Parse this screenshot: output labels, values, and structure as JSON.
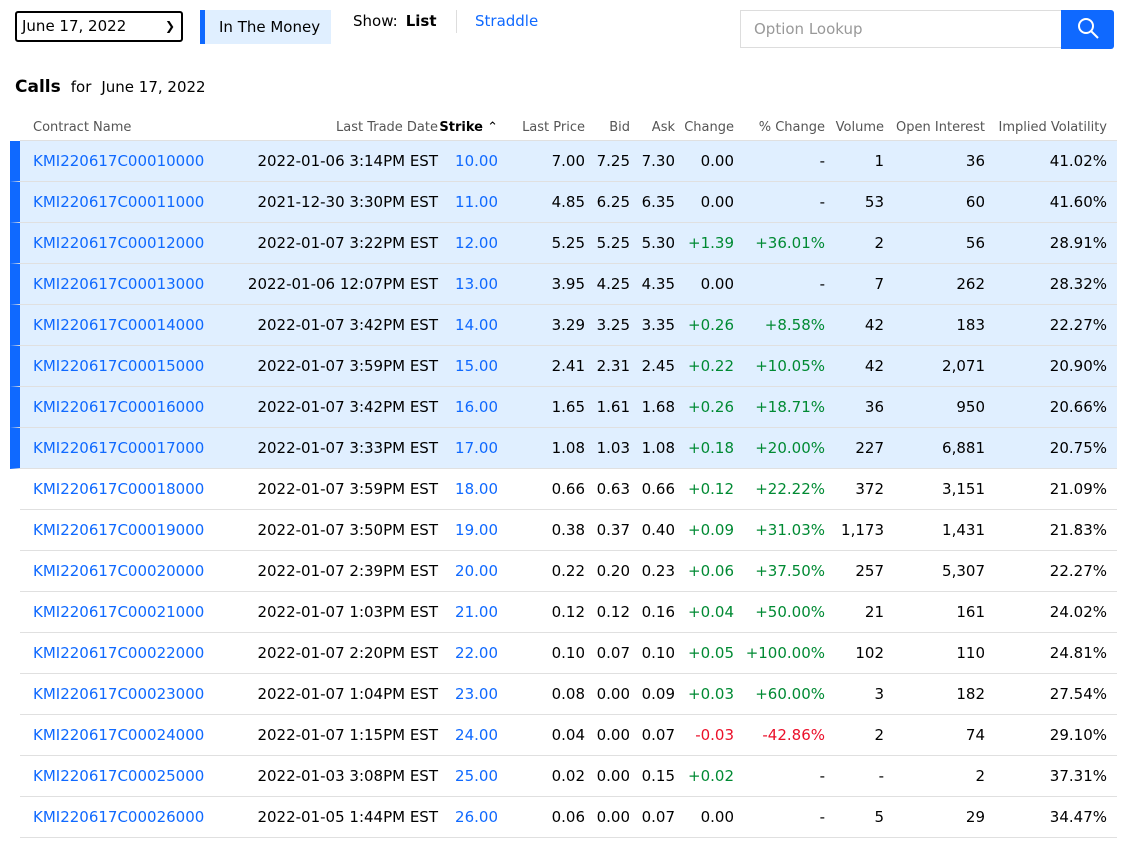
{
  "controls": {
    "date_select": "June 17, 2022",
    "in_the_money": "In The Money",
    "show_label": "Show:",
    "list": "List",
    "straddle": "Straddle",
    "lookup_placeholder": "Option Lookup"
  },
  "section": {
    "title": "Calls",
    "for": "for",
    "date": "June 17, 2022"
  },
  "colors": {
    "accent": "#0f69ff",
    "itm_bg": "#e0efff",
    "positive": "#008a33",
    "negative": "#eb0f29"
  },
  "columns": [
    "Contract Name",
    "Last Trade Date",
    "Strike",
    "Last Price",
    "Bid",
    "Ask",
    "Change",
    "% Change",
    "Volume",
    "Open Interest",
    "Implied Volatility"
  ],
  "sort": {
    "column": "Strike",
    "direction": "ascending"
  },
  "rows": [
    {
      "itm": true,
      "c": [
        "KMI220617C00010000",
        "2022-01-06 3:14PM EST",
        "10.00",
        "7.00",
        "7.25",
        "7.30",
        "0.00",
        "-",
        "1",
        "36",
        "41.02%"
      ]
    },
    {
      "itm": true,
      "c": [
        "KMI220617C00011000",
        "2021-12-30 3:30PM EST",
        "11.00",
        "4.85",
        "6.25",
        "6.35",
        "0.00",
        "-",
        "53",
        "60",
        "41.60%"
      ]
    },
    {
      "itm": true,
      "c": [
        "KMI220617C00012000",
        "2022-01-07 3:22PM EST",
        "12.00",
        "5.25",
        "5.25",
        "5.30",
        "+1.39",
        "+36.01%",
        "2",
        "56",
        "28.91%"
      ]
    },
    {
      "itm": true,
      "c": [
        "KMI220617C00013000",
        "2022-01-06 12:07PM EST",
        "13.00",
        "3.95",
        "4.25",
        "4.35",
        "0.00",
        "-",
        "7",
        "262",
        "28.32%"
      ]
    },
    {
      "itm": true,
      "c": [
        "KMI220617C00014000",
        "2022-01-07 3:42PM EST",
        "14.00",
        "3.29",
        "3.25",
        "3.35",
        "+0.26",
        "+8.58%",
        "42",
        "183",
        "22.27%"
      ]
    },
    {
      "itm": true,
      "c": [
        "KMI220617C00015000",
        "2022-01-07 3:59PM EST",
        "15.00",
        "2.41",
        "2.31",
        "2.45",
        "+0.22",
        "+10.05%",
        "42",
        "2,071",
        "20.90%"
      ]
    },
    {
      "itm": true,
      "c": [
        "KMI220617C00016000",
        "2022-01-07 3:42PM EST",
        "16.00",
        "1.65",
        "1.61",
        "1.68",
        "+0.26",
        "+18.71%",
        "36",
        "950",
        "20.66%"
      ]
    },
    {
      "itm": true,
      "c": [
        "KMI220617C00017000",
        "2022-01-07 3:33PM EST",
        "17.00",
        "1.08",
        "1.03",
        "1.08",
        "+0.18",
        "+20.00%",
        "227",
        "6,881",
        "20.75%"
      ]
    },
    {
      "itm": false,
      "c": [
        "KMI220617C00018000",
        "2022-01-07 3:59PM EST",
        "18.00",
        "0.66",
        "0.63",
        "0.66",
        "+0.12",
        "+22.22%",
        "372",
        "3,151",
        "21.09%"
      ]
    },
    {
      "itm": false,
      "c": [
        "KMI220617C00019000",
        "2022-01-07 3:50PM EST",
        "19.00",
        "0.38",
        "0.37",
        "0.40",
        "+0.09",
        "+31.03%",
        "1,173",
        "1,431",
        "21.83%"
      ]
    },
    {
      "itm": false,
      "c": [
        "KMI220617C00020000",
        "2022-01-07 2:39PM EST",
        "20.00",
        "0.22",
        "0.20",
        "0.23",
        "+0.06",
        "+37.50%",
        "257",
        "5,307",
        "22.27%"
      ]
    },
    {
      "itm": false,
      "c": [
        "KMI220617C00021000",
        "2022-01-07 1:03PM EST",
        "21.00",
        "0.12",
        "0.12",
        "0.16",
        "+0.04",
        "+50.00%",
        "21",
        "161",
        "24.02%"
      ]
    },
    {
      "itm": false,
      "c": [
        "KMI220617C00022000",
        "2022-01-07 2:20PM EST",
        "22.00",
        "0.10",
        "0.07",
        "0.10",
        "+0.05",
        "+100.00%",
        "102",
        "110",
        "24.81%"
      ]
    },
    {
      "itm": false,
      "c": [
        "KMI220617C00023000",
        "2022-01-07 1:04PM EST",
        "23.00",
        "0.08",
        "0.00",
        "0.09",
        "+0.03",
        "+60.00%",
        "3",
        "182",
        "27.54%"
      ]
    },
    {
      "itm": false,
      "c": [
        "KMI220617C00024000",
        "2022-01-07 1:15PM EST",
        "24.00",
        "0.04",
        "0.00",
        "0.07",
        "-0.03",
        "-42.86%",
        "2",
        "74",
        "29.10%"
      ]
    },
    {
      "itm": false,
      "c": [
        "KMI220617C00025000",
        "2022-01-03 3:08PM EST",
        "25.00",
        "0.02",
        "0.00",
        "0.15",
        "+0.02",
        "-",
        "-",
        "2",
        "37.31%"
      ]
    },
    {
      "itm": false,
      "c": [
        "KMI220617C00026000",
        "2022-01-05 1:44PM EST",
        "26.00",
        "0.06",
        "0.00",
        "0.07",
        "0.00",
        "-",
        "5",
        "29",
        "34.47%"
      ]
    }
  ]
}
